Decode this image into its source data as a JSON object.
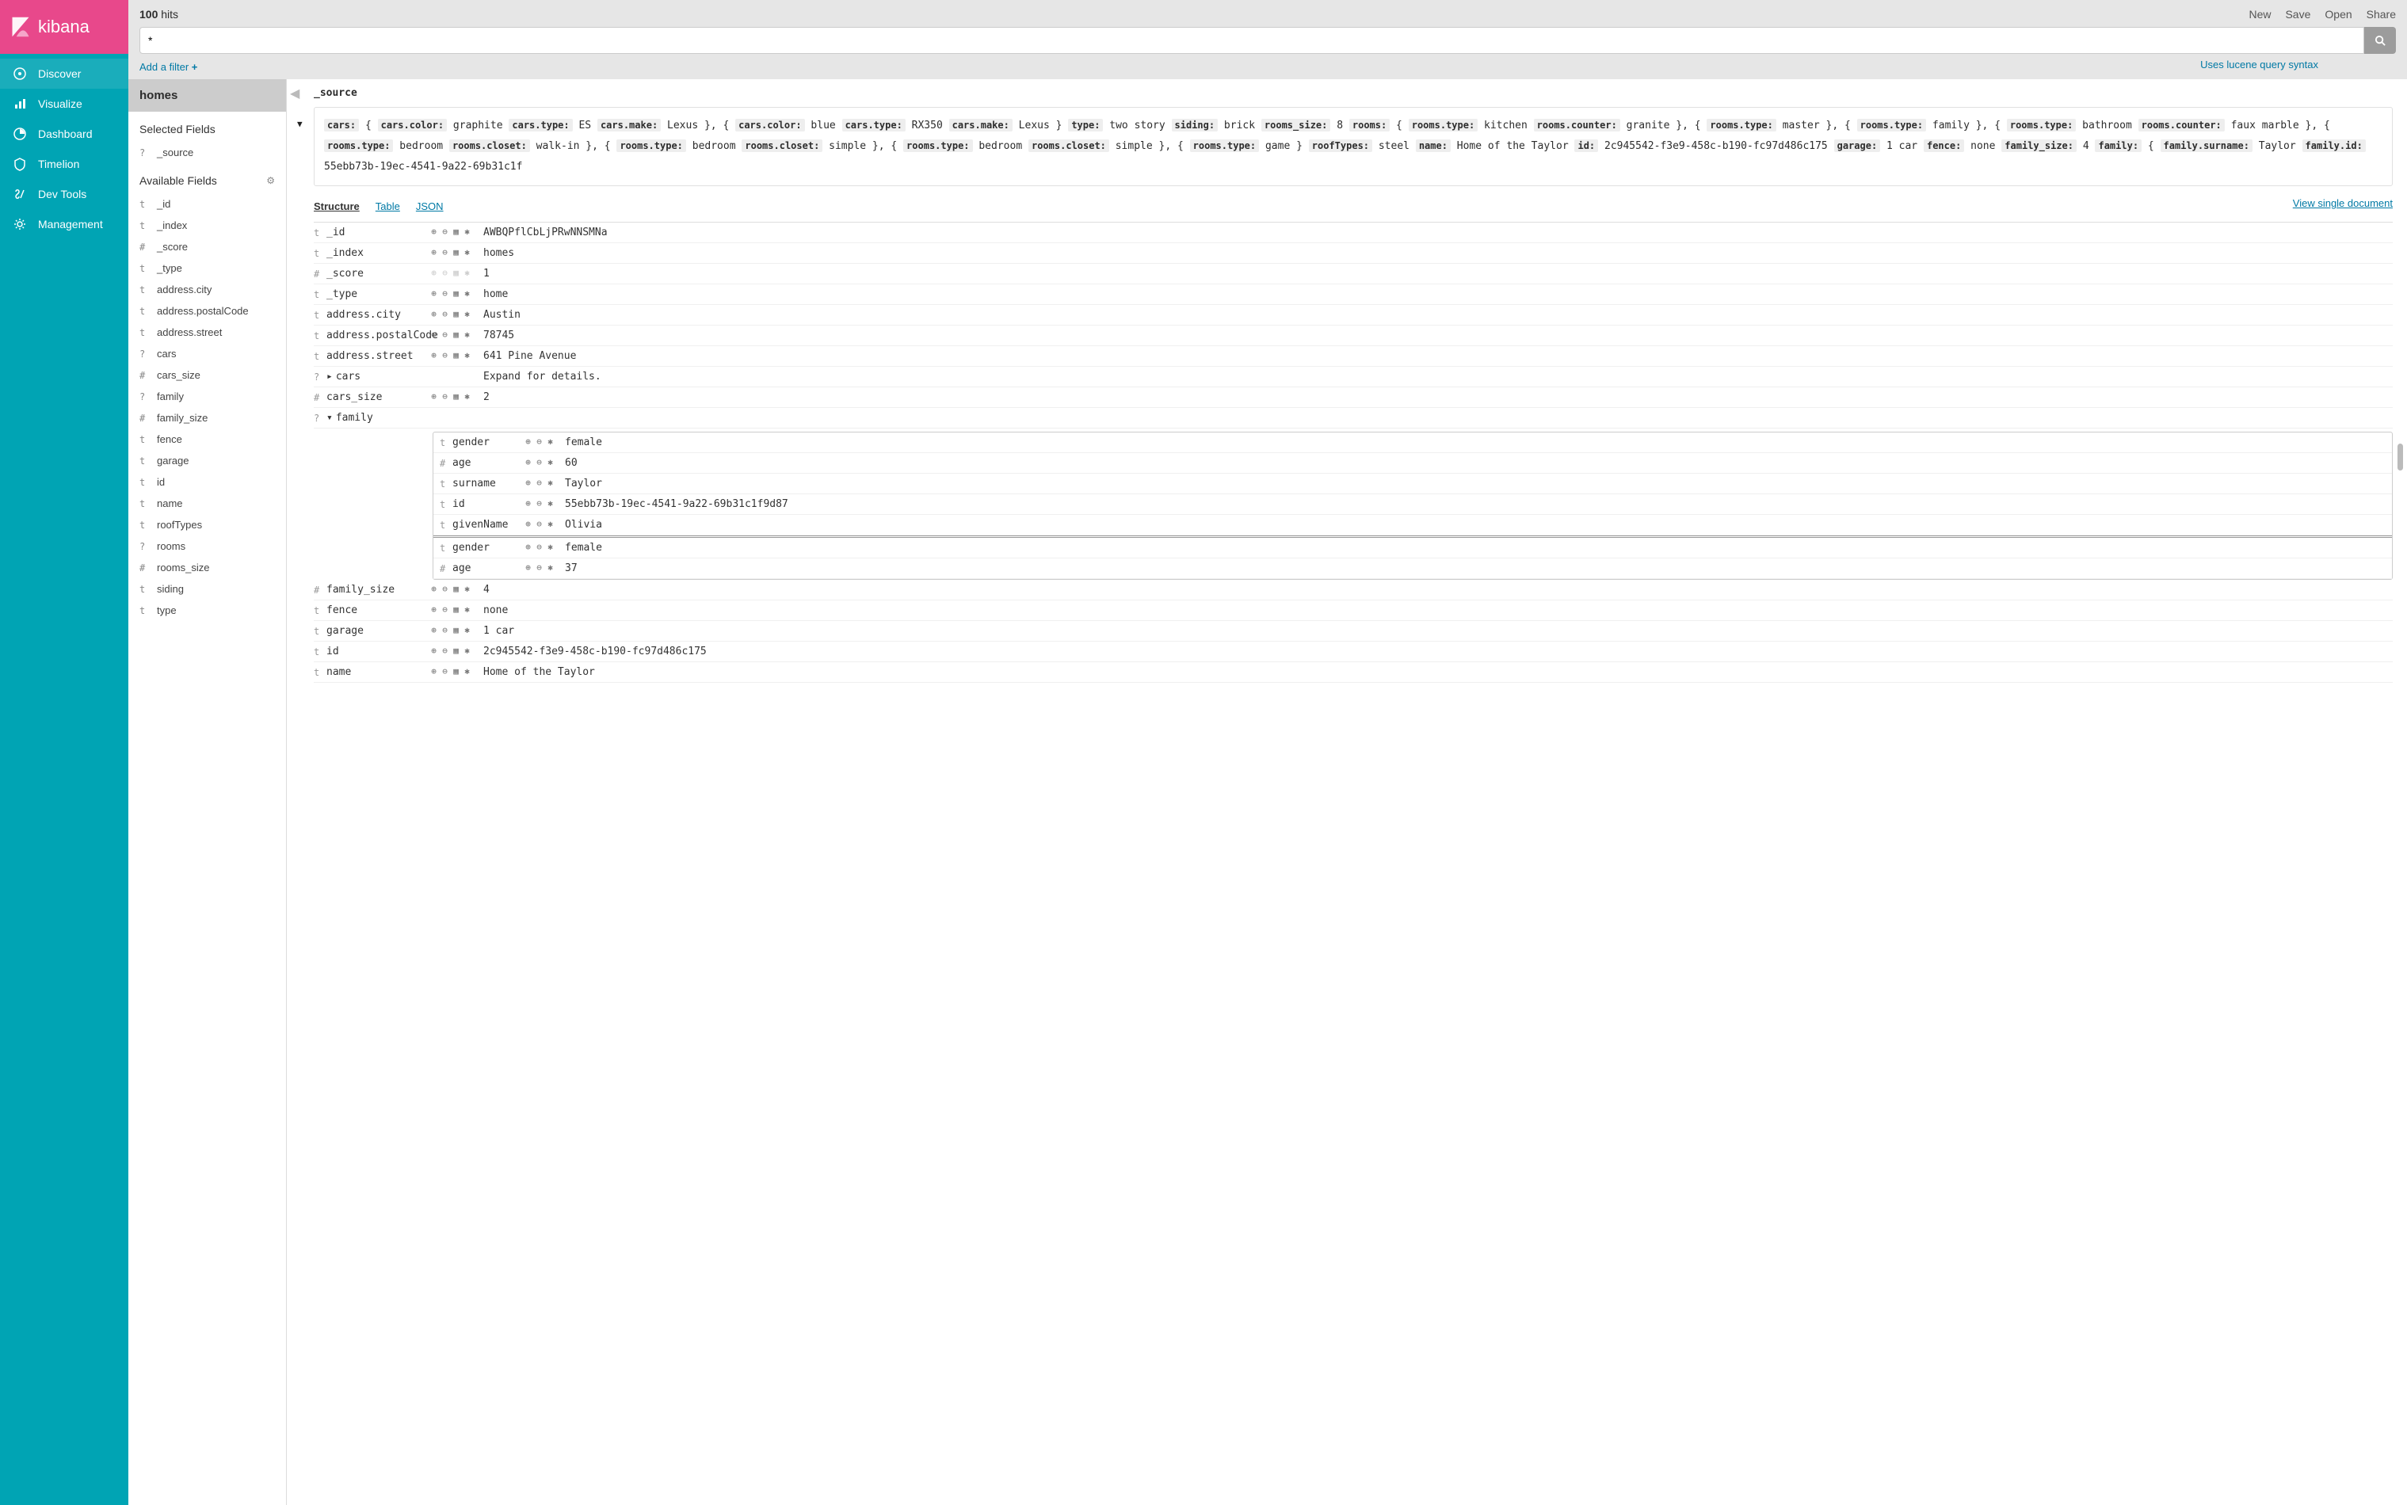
{
  "brand": "kibana",
  "nav": [
    {
      "label": "Discover",
      "active": true
    },
    {
      "label": "Visualize",
      "active": false
    },
    {
      "label": "Dashboard",
      "active": false
    },
    {
      "label": "Timelion",
      "active": false
    },
    {
      "label": "Dev Tools",
      "active": false
    },
    {
      "label": "Management",
      "active": false
    }
  ],
  "topbar": {
    "hits_num": "100",
    "hits_label": "hits",
    "actions": [
      "New",
      "Save",
      "Open",
      "Share"
    ],
    "query": "*",
    "lucene_hint": "Uses lucene query syntax",
    "add_filter": "Add a filter"
  },
  "fields": {
    "index": "homes",
    "selected_title": "Selected Fields",
    "selected": [
      {
        "type": "?",
        "name": "_source"
      }
    ],
    "available_title": "Available Fields",
    "available": [
      {
        "type": "t",
        "name": "_id"
      },
      {
        "type": "t",
        "name": "_index"
      },
      {
        "type": "#",
        "name": "_score"
      },
      {
        "type": "t",
        "name": "_type"
      },
      {
        "type": "t",
        "name": "address.city"
      },
      {
        "type": "t",
        "name": "address.postalCode"
      },
      {
        "type": "t",
        "name": "address.street"
      },
      {
        "type": "?",
        "name": "cars"
      },
      {
        "type": "#",
        "name": "cars_size"
      },
      {
        "type": "?",
        "name": "family"
      },
      {
        "type": "#",
        "name": "family_size"
      },
      {
        "type": "t",
        "name": "fence"
      },
      {
        "type": "t",
        "name": "garage"
      },
      {
        "type": "t",
        "name": "id"
      },
      {
        "type": "t",
        "name": "name"
      },
      {
        "type": "t",
        "name": "roofTypes"
      },
      {
        "type": "?",
        "name": "rooms"
      },
      {
        "type": "#",
        "name": "rooms_size"
      },
      {
        "type": "t",
        "name": "siding"
      },
      {
        "type": "t",
        "name": "type"
      }
    ]
  },
  "doc": {
    "source_label": "_source",
    "source_pairs": [
      {
        "k": "cars:",
        "v": "{"
      },
      {
        "k": "cars.color:",
        "v": "graphite"
      },
      {
        "k": "cars.type:",
        "v": "ES"
      },
      {
        "k": "cars.make:",
        "v": "Lexus }, {"
      },
      {
        "k": "cars.color:",
        "v": "blue"
      },
      {
        "k": "cars.type:",
        "v": "RX350"
      },
      {
        "k": "cars.make:",
        "v": "Lexus }"
      },
      {
        "k": "type:",
        "v": "two story"
      },
      {
        "k": "siding:",
        "v": "brick"
      },
      {
        "k": "rooms_size:",
        "v": "8"
      },
      {
        "k": "rooms:",
        "v": "{"
      },
      {
        "k": "rooms.type:",
        "v": "kitchen"
      },
      {
        "k": "rooms.counter:",
        "v": "granite }, {"
      },
      {
        "k": "rooms.type:",
        "v": "master }, {"
      },
      {
        "k": "rooms.type:",
        "v": "family }, {"
      },
      {
        "k": "rooms.type:",
        "v": "bathroom"
      },
      {
        "k": "rooms.counter:",
        "v": "faux marble }, {"
      },
      {
        "k": "rooms.type:",
        "v": "bedroom"
      },
      {
        "k": "rooms.closet:",
        "v": "walk-in }, {"
      },
      {
        "k": "rooms.type:",
        "v": "bedroom"
      },
      {
        "k": "rooms.closet:",
        "v": "simple }, {"
      },
      {
        "k": "rooms.type:",
        "v": "bedroom"
      },
      {
        "k": "rooms.closet:",
        "v": "simple }, {"
      },
      {
        "k": "rooms.type:",
        "v": "game }"
      },
      {
        "k": "roofTypes:",
        "v": "steel"
      },
      {
        "k": "name:",
        "v": "Home of the Taylor"
      },
      {
        "k": "id:",
        "v": "2c945542-f3e9-458c-b190-fc97d486c175"
      },
      {
        "k": "garage:",
        "v": "1 car"
      },
      {
        "k": "fence:",
        "v": "none"
      },
      {
        "k": "family_size:",
        "v": "4"
      },
      {
        "k": "family:",
        "v": "{"
      },
      {
        "k": "family.surname:",
        "v": "Taylor"
      },
      {
        "k": "family.id:",
        "v": "55ebb73b-19ec-4541-9a22-69b31c1f"
      }
    ],
    "tabs": {
      "structure": "Structure",
      "table": "Table",
      "json": "JSON",
      "view_single": "View single document"
    },
    "rows": [
      {
        "ft": "t",
        "name": "_id",
        "icons": "full",
        "val": "AWBQPflCbLjPRwNNSMNa"
      },
      {
        "ft": "t",
        "name": "_index",
        "icons": "full",
        "val": "homes"
      },
      {
        "ft": "#",
        "name": "_score",
        "icons": "muted",
        "val": "1"
      },
      {
        "ft": "t",
        "name": "_type",
        "icons": "full",
        "val": "home"
      },
      {
        "ft": "t",
        "name": "address.city",
        "icons": "full",
        "val": "Austin"
      },
      {
        "ft": "t",
        "name": "address.postalCode",
        "icons": "full",
        "val": "78745"
      },
      {
        "ft": "t",
        "name": "address.street",
        "icons": "full",
        "val": "641 Pine Avenue"
      },
      {
        "ft": "?",
        "name": "cars",
        "icons": "none",
        "val": "Expand for details.",
        "caret": "right"
      },
      {
        "ft": "#",
        "name": "cars_size",
        "icons": "full",
        "val": "2"
      },
      {
        "ft": "?",
        "name": "family",
        "icons": "none",
        "val": "",
        "caret": "down",
        "nested": true
      },
      {
        "ft": "#",
        "name": "family_size",
        "icons": "full",
        "val": "4"
      },
      {
        "ft": "t",
        "name": "fence",
        "icons": "full",
        "val": "none"
      },
      {
        "ft": "t",
        "name": "garage",
        "icons": "full",
        "val": "1 car"
      },
      {
        "ft": "t",
        "name": "id",
        "icons": "full",
        "val": "2c945542-f3e9-458c-b190-fc97d486c175"
      },
      {
        "ft": "t",
        "name": "name",
        "icons": "full",
        "val": "Home of the Taylor"
      }
    ],
    "nested1": [
      {
        "ft": "t",
        "name": "gender",
        "val": "female"
      },
      {
        "ft": "#",
        "name": "age",
        "val": "60"
      },
      {
        "ft": "t",
        "name": "surname",
        "val": "Taylor"
      },
      {
        "ft": "t",
        "name": "id",
        "val": "55ebb73b-19ec-4541-9a22-69b31c1f9d87"
      },
      {
        "ft": "t",
        "name": "givenName",
        "val": "Olivia"
      }
    ],
    "nested2": [
      {
        "ft": "t",
        "name": "gender",
        "val": "female"
      },
      {
        "ft": "#",
        "name": "age",
        "val": "37"
      }
    ]
  }
}
